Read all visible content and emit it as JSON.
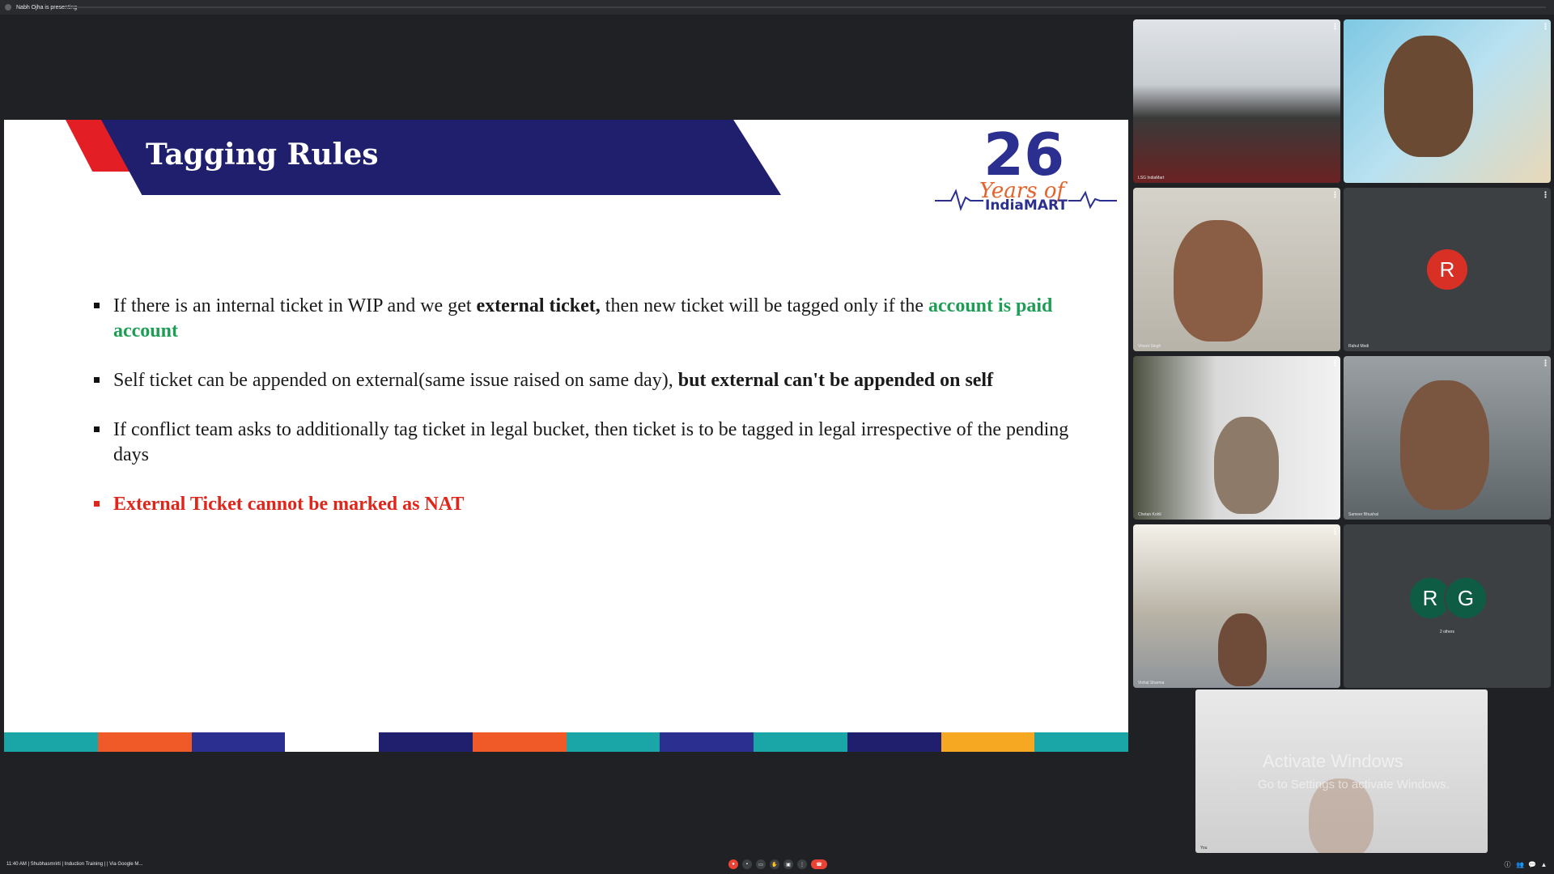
{
  "topbar": {
    "presenting_text": "Nabh Ojha is presenting"
  },
  "slide": {
    "title": "Tagging Rules",
    "logo": {
      "number": "26",
      "tagline": "Years of",
      "brand": "IndiaMART"
    },
    "bullets": [
      {
        "part1": "If there is an internal ticket in WIP and we get ",
        "bold": "external ticket,",
        "part2": " then new ticket will be tagged only if the ",
        "green": "account is paid account"
      },
      {
        "part1": "Self ticket can be appended on external(same issue raised on same day), ",
        "bold": "but external can't be appended on self"
      },
      {
        "part1": "If conflict team asks to additionally tag ticket in legal bucket, then ticket is to be tagged in legal irrespective of the pending days"
      },
      {
        "red": "External Ticket cannot be marked as NAT"
      }
    ]
  },
  "participants": [
    {
      "name": "LSG IndiaMart",
      "type": "video"
    },
    {
      "name": "",
      "type": "video"
    },
    {
      "name": "Vineet Singh",
      "type": "video"
    },
    {
      "name": "Rahul Modi",
      "type": "avatar",
      "initials": "R",
      "color": "#d93025"
    },
    {
      "name": "Chetan Kohli",
      "type": "video"
    },
    {
      "name": "Sameer Bhushal",
      "type": "video"
    },
    {
      "name": "Vishal Sharma",
      "type": "video"
    },
    {
      "name": "2 others",
      "type": "avatars",
      "initials": [
        "R",
        "G"
      ],
      "color": "#0f5c44"
    }
  ],
  "self_view": {
    "name": "You",
    "watermark_title": "Activate Windows",
    "watermark_sub": "Go to Settings to activate Windows."
  },
  "bottombar": {
    "meeting_info": "11:40 AM  |  Shubhasmrirti | Induction Training | | Via Google M..."
  },
  "colors": {
    "background": "#202124",
    "ribbon_blue": "#1f1f6e",
    "ribbon_red": "#e31e24",
    "accent_green": "#1e9e55",
    "accent_red": "#e0261b",
    "end_call": "#ea4335"
  }
}
